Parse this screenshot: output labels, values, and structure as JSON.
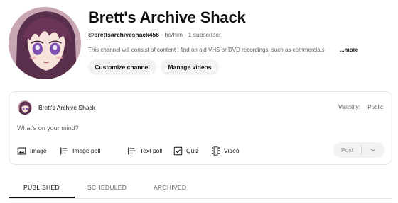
{
  "channel": {
    "title": "Brett's Archive Shack",
    "handle": "@brettsarchiveshack456",
    "pronouns": "he/him",
    "subscribers": "1 subscriber",
    "separator": "·",
    "description": "This channel will consist of content I find on old VHS or DVD recordings, such as commercials",
    "more_label": "...more",
    "avatar": "anime-girl-avatar"
  },
  "actions": {
    "customize_label": "Customize channel",
    "manage_label": "Manage videos"
  },
  "composer": {
    "channel_name": "Brett's Archive Shack",
    "visibility_label": "Visibility:",
    "visibility_value": "Public",
    "placeholder": "What's on your mind?",
    "tools": [
      {
        "label": "Image",
        "icon": "image-icon"
      },
      {
        "label": "Image poll",
        "icon": "image-poll-icon"
      },
      {
        "label": "Text poll",
        "icon": "text-poll-icon"
      },
      {
        "label": "Quiz",
        "icon": "quiz-icon"
      },
      {
        "label": "Video",
        "icon": "video-icon"
      }
    ],
    "post_label": "Post"
  },
  "tabs": [
    {
      "label": "PUBLISHED",
      "active": true
    },
    {
      "label": "SCHEDULED",
      "active": false
    },
    {
      "label": "ARCHIVED",
      "active": false
    }
  ]
}
